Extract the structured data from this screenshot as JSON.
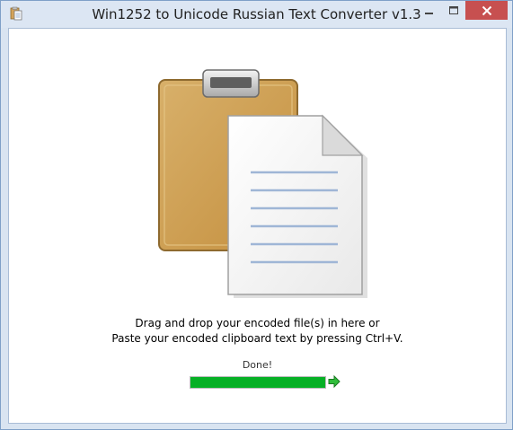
{
  "window": {
    "title": "Win1252 to Unicode Russian Text Converter v1.3",
    "controls": [
      "minimize-icon",
      "maximize-icon",
      "close-icon"
    ]
  },
  "dropzone": {
    "icon": "clipboard-document-icon",
    "line1": "Drag and drop your encoded file(s) in here or",
    "line2": "Paste your encoded clipboard text by pressing Ctrl+V."
  },
  "status": {
    "text": "Done!",
    "progress": 1.0,
    "progress_color": "#06b025",
    "arrow_icon": "green-arrow-right-icon"
  },
  "colors": {
    "close_button": "#c75050",
    "clipboard": "#c99a48",
    "window_frame": "#d9e4f1"
  }
}
